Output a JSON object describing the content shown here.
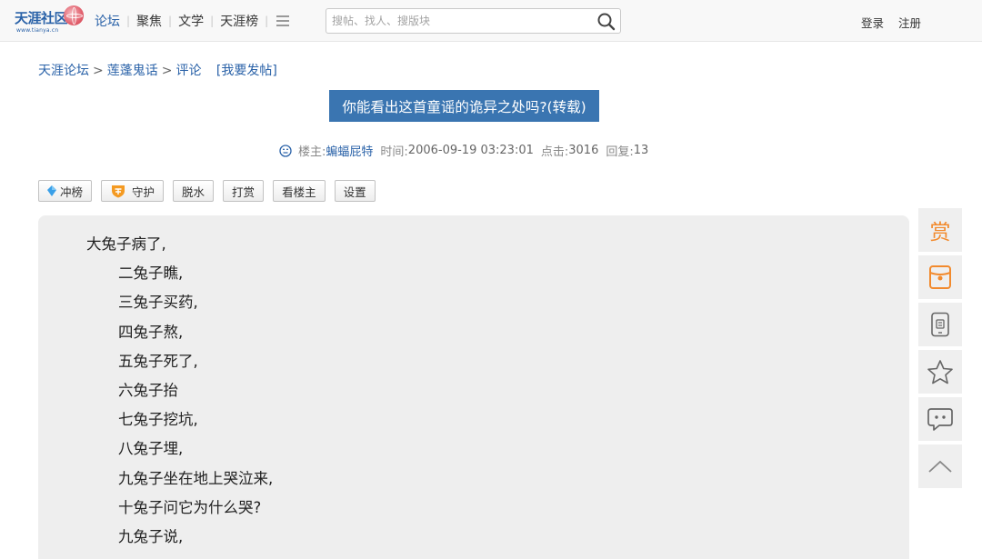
{
  "header": {
    "logo_text": "天涯社区",
    "logo_sub": "www.tianya.cn",
    "nav": [
      {
        "label": "论坛",
        "active": true
      },
      {
        "label": "聚焦",
        "active": false
      },
      {
        "label": "文学",
        "active": false
      },
      {
        "label": "天涯榜",
        "active": false
      }
    ],
    "search_placeholder": "搜帖、找人、搜版块",
    "login": "登录",
    "register": "注册"
  },
  "breadcrumb": {
    "forum": "天涯论坛",
    "board": "莲蓬鬼话",
    "section": "评论",
    "post_link": "[我要发帖]"
  },
  "post": {
    "title": "你能看出这首童谣的诡异之处吗?(转载)",
    "author_label": "楼主:",
    "author": "蝙蝠屁特",
    "time_label": "时间:",
    "time": "2006-09-19 03:23:01",
    "clicks_label": "点击:",
    "clicks": "3016",
    "replies_label": "回复:",
    "replies": "13"
  },
  "toolbar": {
    "rank": "冲榜",
    "guard": "守护",
    "dehydrate": "脱水",
    "reward": "打赏",
    "author_only": "看楼主",
    "settings": "设置"
  },
  "content": {
    "lines": [
      {
        "text": "大兔子病了,",
        "indent": false
      },
      {
        "text": "二兔子瞧,",
        "indent": true
      },
      {
        "text": "三兔子买药,",
        "indent": true
      },
      {
        "text": "四兔子熬,",
        "indent": true
      },
      {
        "text": "五兔子死了,",
        "indent": true
      },
      {
        "text": "六兔子抬",
        "indent": true
      },
      {
        "text": "七兔子挖坑,",
        "indent": true
      },
      {
        "text": "八兔子埋,",
        "indent": true
      },
      {
        "text": "九兔子坐在地上哭泣来,",
        "indent": true
      },
      {
        "text": "十兔子问它为什么哭?",
        "indent": true
      },
      {
        "text": "九兔子说,",
        "indent": true
      }
    ]
  },
  "sidebar": {
    "reward_label": "赏"
  },
  "colors": {
    "brand": "#2a62a8",
    "title_bg": "#3a75b1",
    "accent_orange": "#f28a2d",
    "content_bg": "#eeeeee"
  }
}
